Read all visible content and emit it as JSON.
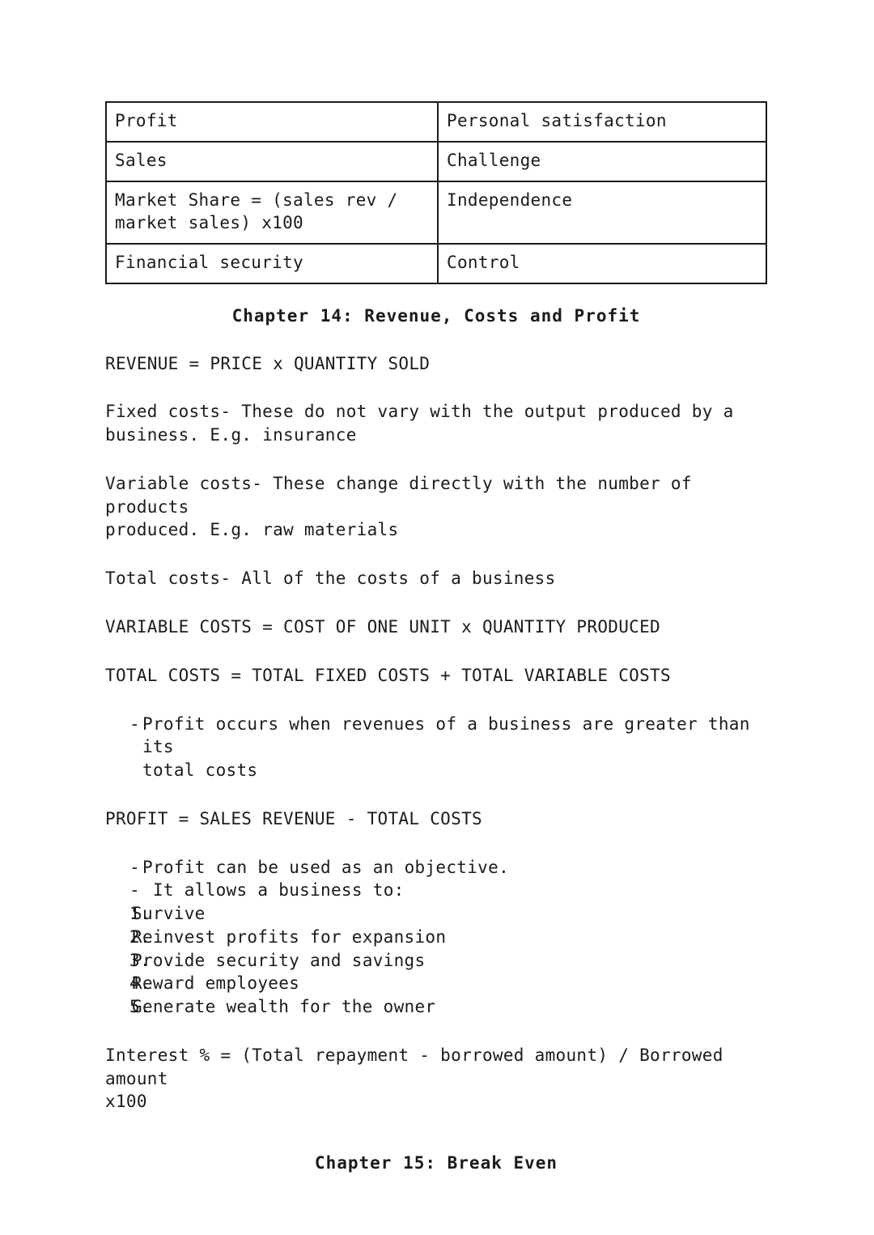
{
  "document": {
    "type": "study-notes",
    "background_color": "#ffffff",
    "text_color": "#1b1b1b",
    "border_color": "#1b1b1b"
  },
  "table": {
    "name": "business-objectives-table",
    "rows": [
      {
        "left_lines": [
          "Profit"
        ],
        "right_lines": [
          "Personal satisfaction"
        ]
      },
      {
        "left_lines": [
          "Sales"
        ],
        "right_lines": [
          "Challenge"
        ]
      },
      {
        "left_lines": [
          "Market Share = (sales rev /",
          "market sales) x100"
        ],
        "right_lines": [
          "Independence"
        ]
      },
      {
        "left_lines": [
          "Financial security"
        ],
        "right_lines": [
          "Control"
        ]
      }
    ]
  },
  "chapter14": {
    "heading": "Chapter 14: Revenue, Costs and Profit",
    "revenue_formula": "REVENUE = PRICE x QUANTITY SOLD",
    "fixed_costs": "Fixed costs- These do not vary with the output produced by a\nbusiness. E.g. insurance",
    "variable_costs": "Variable costs- These change directly with the number of products\nproduced. E.g. raw materials",
    "total_costs_def": "Total costs- All of the costs of a business",
    "variable_costs_formula": "VARIABLE COSTS = COST OF ONE UNIT x QUANTITY PRODUCED",
    "total_costs_formula": "TOTAL COSTS = TOTAL FIXED COSTS + TOTAL VARIABLE COSTS",
    "profit_bullet": {
      "marker": "-",
      "text": "Profit occurs when revenues of a business are greater than its\ntotal costs"
    },
    "profit_formula": "PROFIT = SALES REVENUE - TOTAL COSTS",
    "objective_bullets": [
      {
        "marker": "-",
        "text": "Profit can be used as an objective."
      },
      {
        "marker": "-",
        "text": " It allows a business to:"
      }
    ],
    "numbered_items": [
      {
        "marker": "1.",
        "text": "Survive"
      },
      {
        "marker": "2.",
        "text": "Reinvest profits for expansion"
      },
      {
        "marker": "3.",
        "text": "Provide security and savings"
      },
      {
        "marker": "4.",
        "text": "Reward employees"
      },
      {
        "marker": "5.",
        "text": "Generate wealth for the owner"
      }
    ],
    "interest_formula": "Interest % = (Total repayment - borrowed amount) / Borrowed amount\nx100"
  },
  "chapter15": {
    "heading": "Chapter 15: Break Even"
  }
}
